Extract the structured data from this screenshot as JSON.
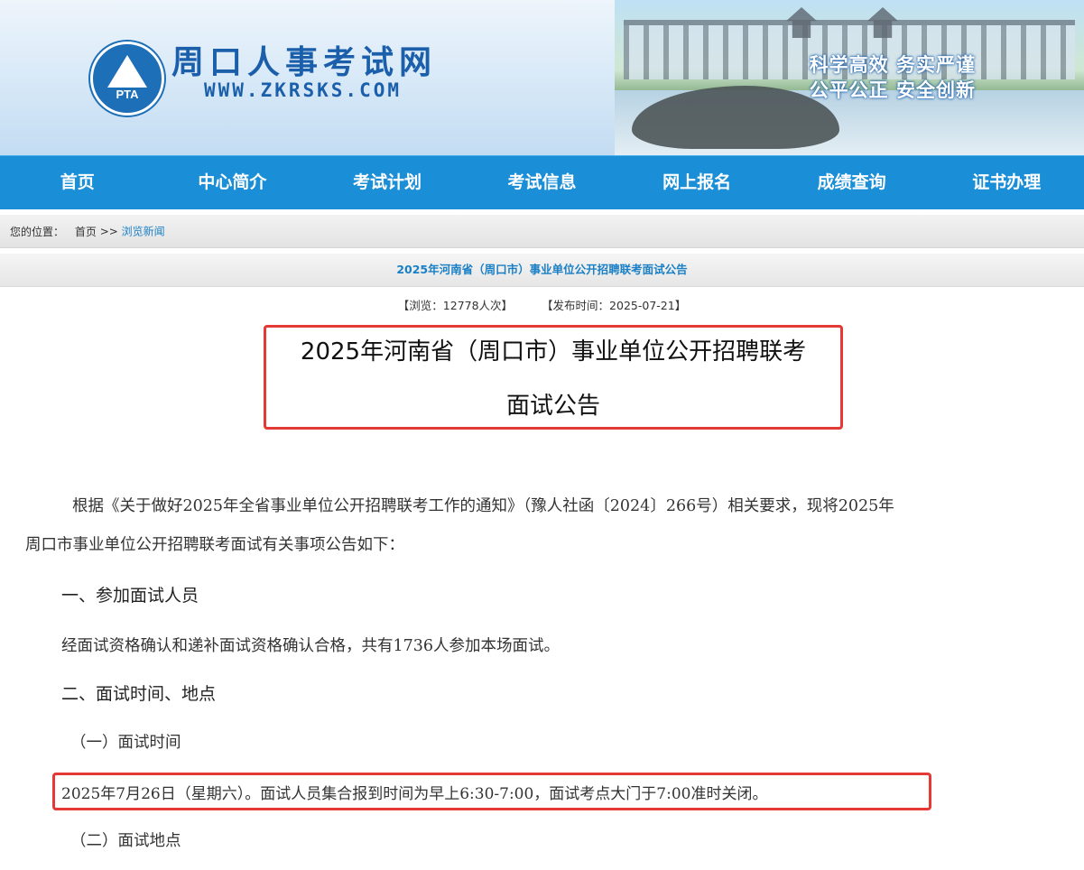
{
  "header": {
    "site_name": "周口人事考试网",
    "site_url": "WWW.ZKRSKS.COM",
    "logo_text": "PTA",
    "slogan_line1": "科学高效 务实严谨",
    "slogan_line2": "公平公正 安全创新"
  },
  "nav": {
    "items": [
      "首页",
      "中心简介",
      "考试计划",
      "考试信息",
      "网上报名",
      "成绩查询",
      "证书办理"
    ]
  },
  "breadcrumb": {
    "label": "您的位置：",
    "home": "首页",
    "separator": ">>",
    "current": "浏览新闻"
  },
  "article": {
    "bar_title": "2025年河南省（周口市）事业单位公开招聘联考面试公告",
    "views": "【浏览：12778人次】",
    "published": "【发布时间：2025-07-21】",
    "title_line1": "2025年河南省（周口市）事业单位公开招聘联考",
    "title_line2": "面试公告",
    "para1": "根据《关于做好2025年全省事业单位公开招聘联考工作的通知》（豫人社函〔2024〕266号）相关要求，现将2025年",
    "para2": "周口市事业单位公开招聘联考面试有关事项公告如下：",
    "section1": "一、参加面试人员",
    "section1_text": "经面试资格确认和递补面试资格确认合格，共有1736人参加本场面试。",
    "section2": "二、面试时间、地点",
    "sub1": "（一）面试时间",
    "sub1_text": "2025年7月26日（星期六）。面试人员集合报到时间为早上6:30-7:00，面试考点大门于7:00准时关闭。",
    "sub2": "（二）面试地点"
  },
  "colors": {
    "nav_bg": "#1a8ed6",
    "link": "#1a7fc4",
    "highlight_border": "#e53935"
  }
}
